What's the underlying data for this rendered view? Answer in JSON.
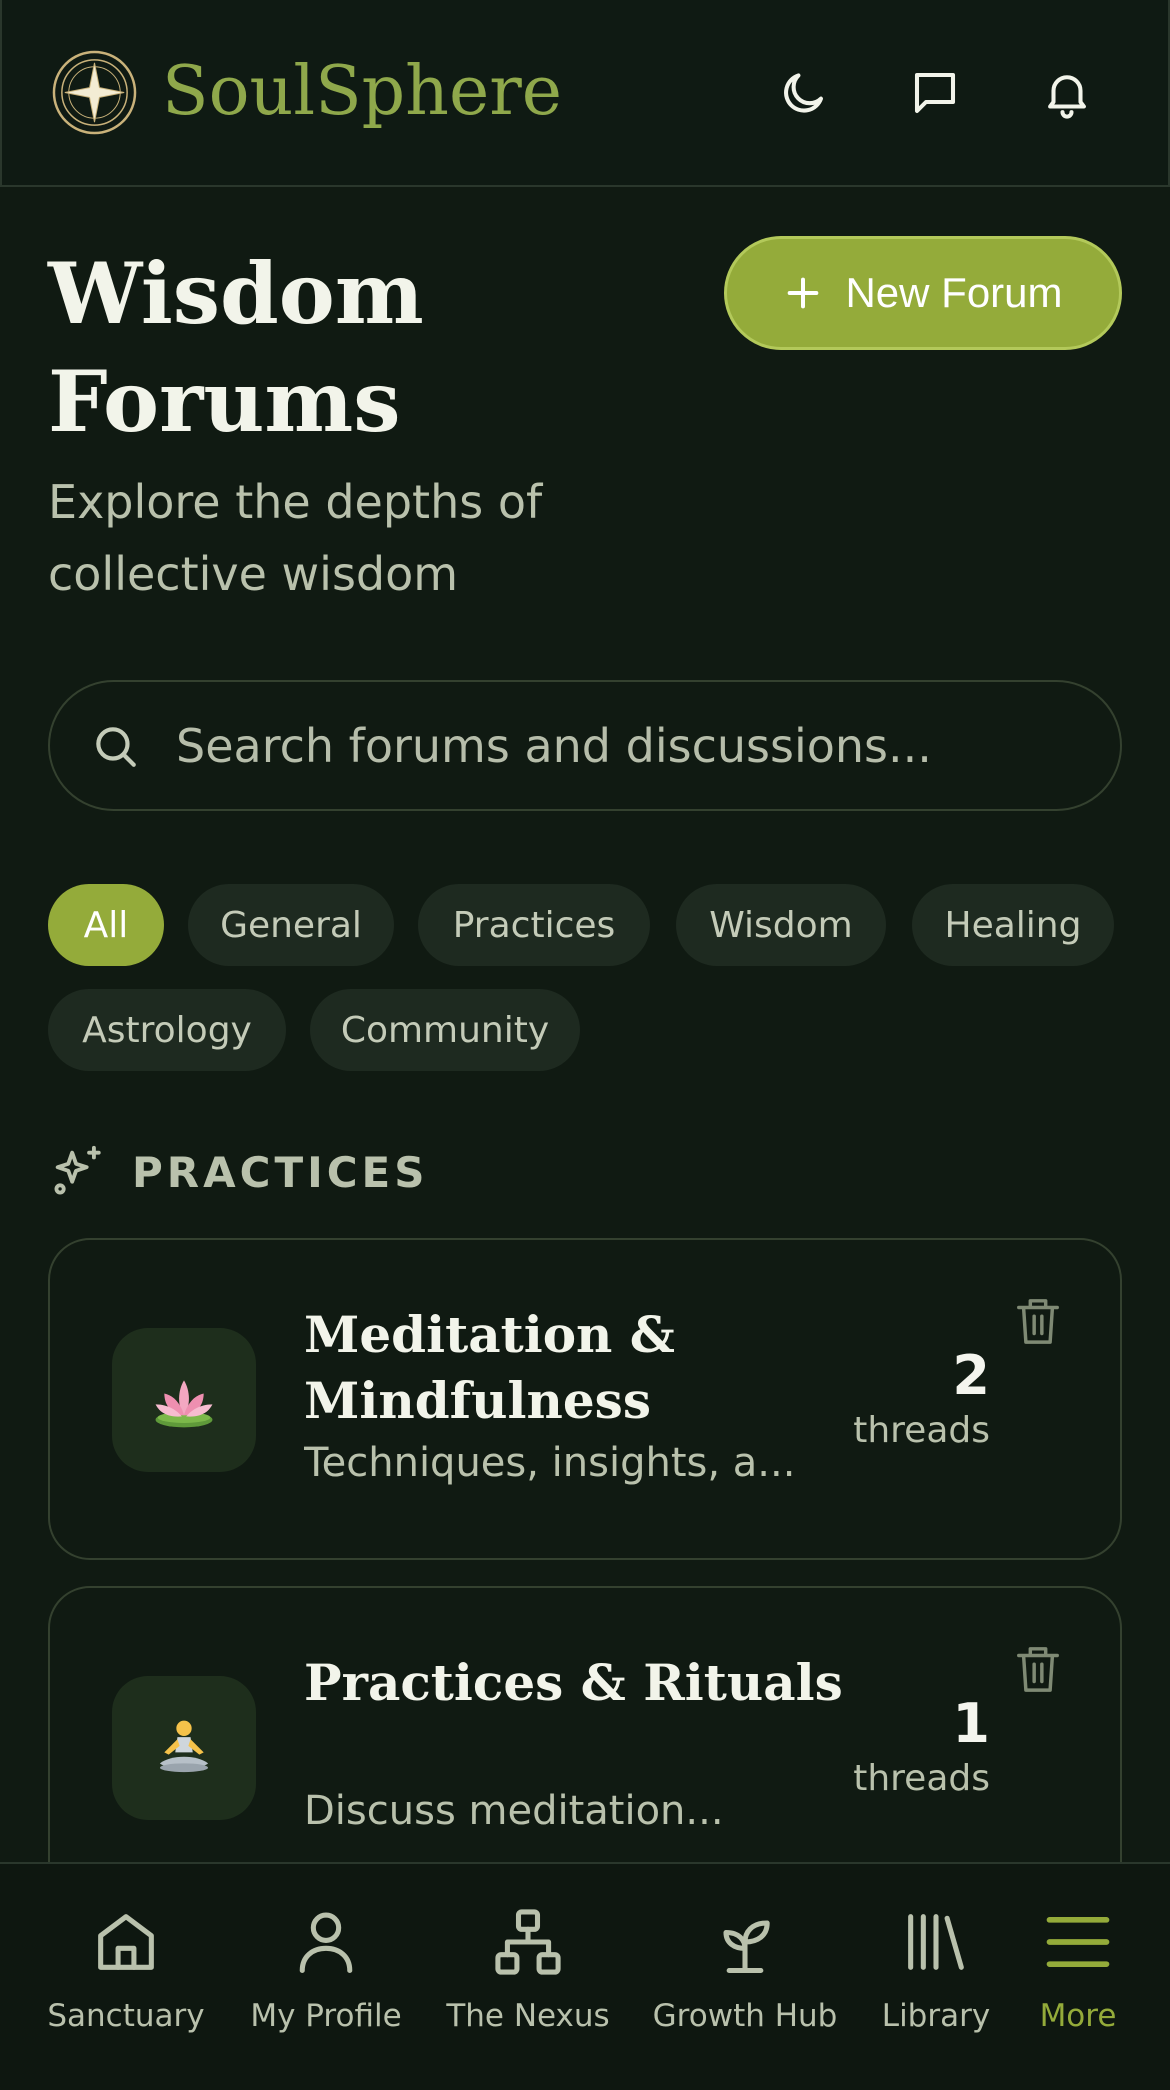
{
  "header": {
    "brand": "SoulSphere",
    "icons": [
      "theme-moon-icon",
      "messages-icon",
      "notifications-bell-icon"
    ]
  },
  "page": {
    "title": "Wisdom Forums",
    "subtitle": "Explore the depths of collective wisdom",
    "new_forum_label": "New Forum"
  },
  "search": {
    "placeholder": "Search forums and discussions..."
  },
  "filters": {
    "selected": "All",
    "chips": [
      "All",
      "General",
      "Practices",
      "Wisdom",
      "Healing",
      "Astrology",
      "Community"
    ]
  },
  "section": {
    "label": "PRACTICES",
    "icon": "sparkles-icon"
  },
  "forums": [
    {
      "title": "Meditation & Mindfulness",
      "description": "Techniques, insights, a...",
      "count": "2",
      "count_label": "threads",
      "icon": "lotus-emoji"
    },
    {
      "title": "Practices & Rituals",
      "description": "Discuss meditation...",
      "count": "1",
      "count_label": "threads",
      "icon": "meditating-person-emoji"
    }
  ],
  "bottom_nav": {
    "active": "More",
    "items": [
      {
        "label": "Sanctuary",
        "icon": "home-icon"
      },
      {
        "label": "My Profile",
        "icon": "user-icon"
      },
      {
        "label": "The Nexus",
        "icon": "network-icon"
      },
      {
        "label": "Growth Hub",
        "icon": "sprout-icon"
      },
      {
        "label": "Library",
        "icon": "library-icon"
      },
      {
        "label": "More",
        "icon": "menu-icon"
      }
    ]
  },
  "colors": {
    "background": "#101a12",
    "accent": "#94ab3a",
    "brand": "#8fa84b",
    "chip": "#1e2a20",
    "muted_text": "#b9c1ac"
  }
}
